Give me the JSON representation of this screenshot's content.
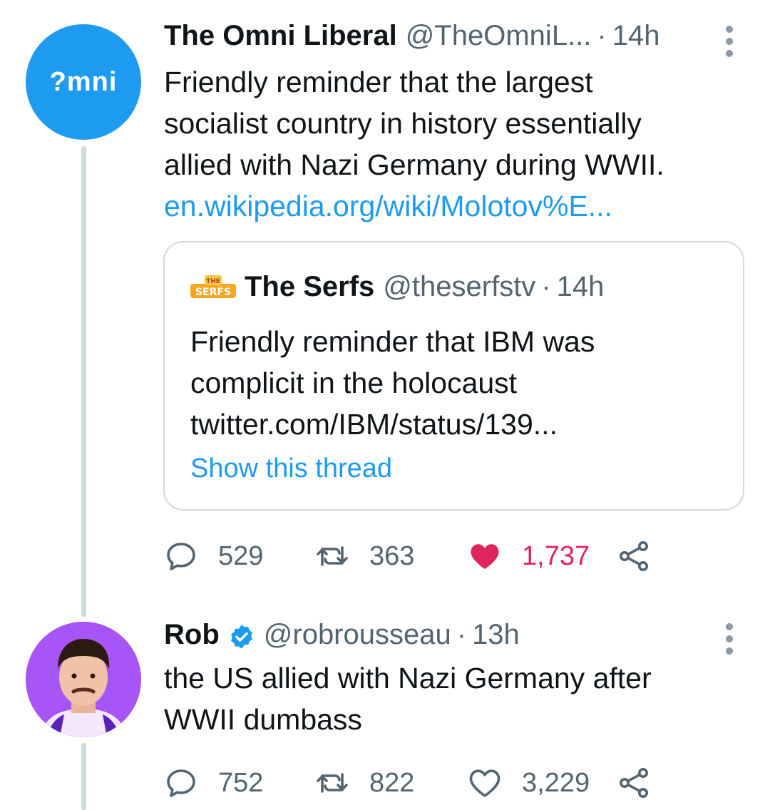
{
  "tweets": [
    {
      "avatar_text": "?mni",
      "name": "The Omni Liberal",
      "handle": "@TheOmniL...",
      "dot": "·",
      "time": "14h",
      "text_lines": [
        "Friendly reminder that the largest",
        "socialist country in history essentially",
        "allied with Nazi Germany during WWII."
      ],
      "link": "en.wikipedia.org/wiki/Molotov%E...",
      "quote": {
        "logo_text": "THE SERFS",
        "name": "The Serfs",
        "handle": "@theserfstv",
        "dot": "·",
        "time": "14h",
        "text_lines": [
          "Friendly reminder that IBM was",
          "complicit in the holocaust",
          "twitter.com/IBM/status/139..."
        ],
        "show_thread": "Show this thread"
      },
      "replies": "529",
      "retweets": "363",
      "likes": "1,737",
      "liked": true
    },
    {
      "name": "Rob",
      "verified": true,
      "handle": "@robrousseau",
      "dot": "·",
      "time": "13h",
      "text_lines": [
        "the US allied with Nazi Germany after",
        "WWII dumbass"
      ],
      "replies": "752",
      "retweets": "822",
      "likes": "3,229",
      "liked": false
    }
  ],
  "colors": {
    "accent": "#1d9bf0",
    "like": "#e0245e",
    "muted": "#536471",
    "thread_line": "#cfd9de"
  },
  "icons": [
    "reply-icon",
    "retweet-icon",
    "heart-icon",
    "share-icon",
    "more-icon",
    "verified-icon"
  ]
}
